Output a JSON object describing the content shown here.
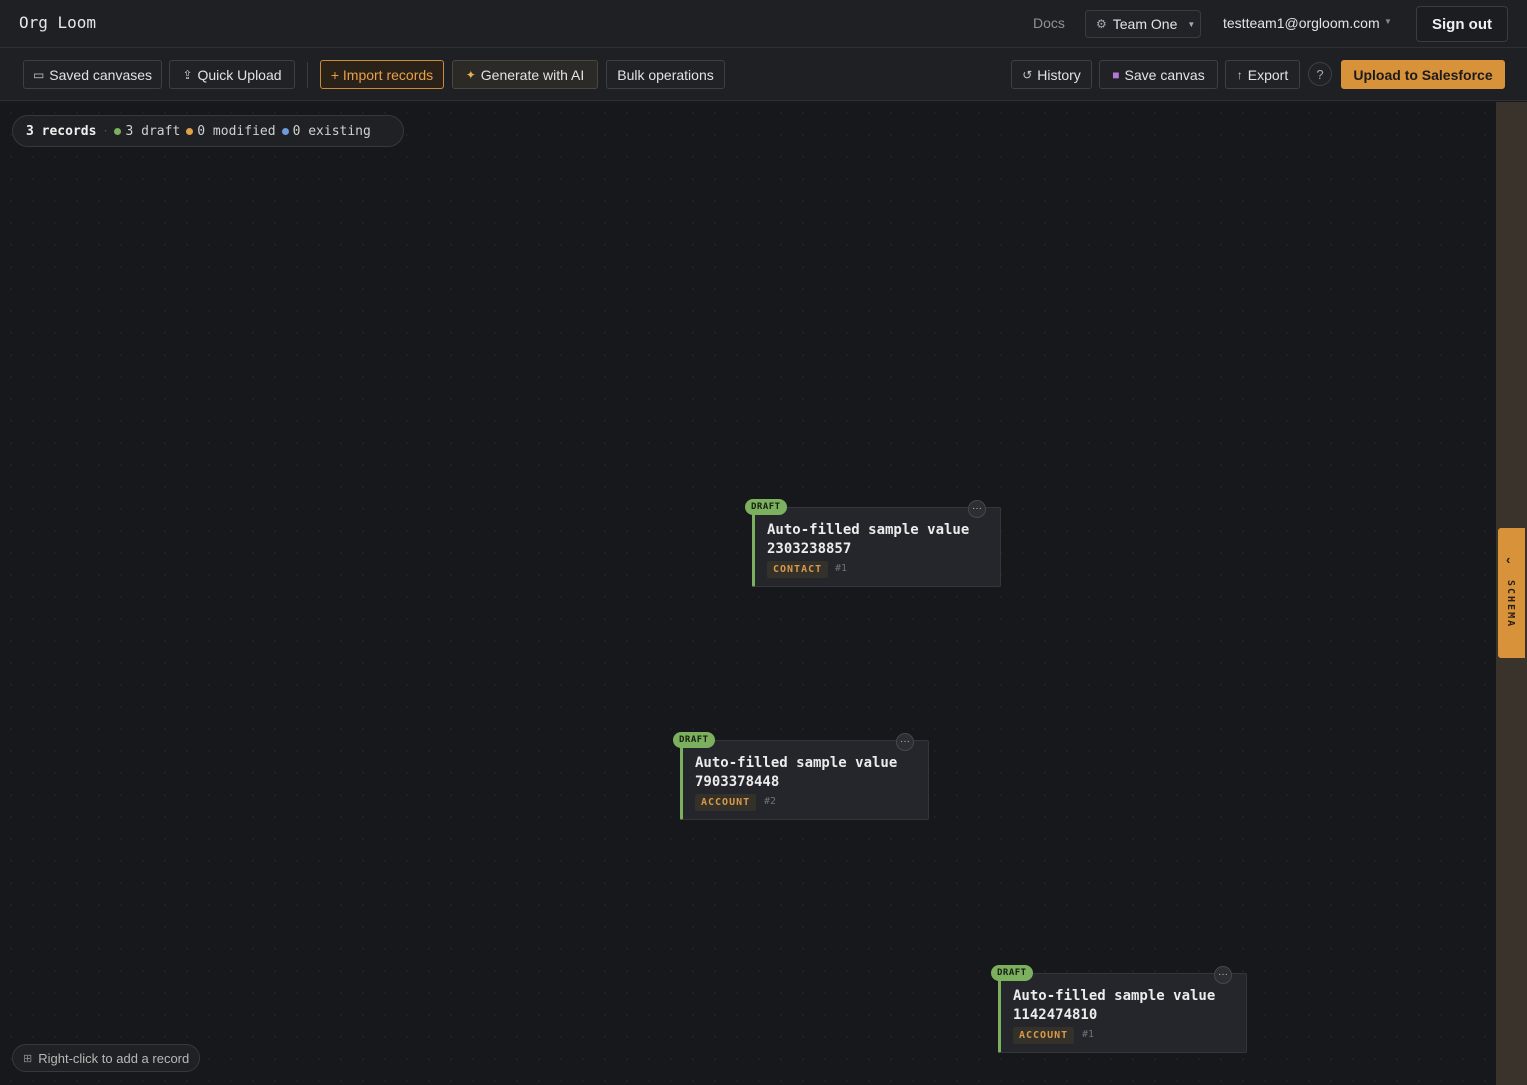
{
  "header": {
    "app_title": "Org Loom",
    "docs_label": "Docs",
    "team": "Team One",
    "user_email": "testteam1@orgloom.com",
    "signout_label": "Sign out"
  },
  "toolbar": {
    "saved_canvases": "Saved canvases",
    "quick_upload": "Quick Upload",
    "import_records": "+ Import records",
    "generate_ai": "Generate with AI",
    "bulk_operations": "Bulk operations",
    "history": "History",
    "save_canvas": "Save canvas",
    "export": "Export",
    "help": "?",
    "upload_salesforce": "Upload to Salesforce"
  },
  "summary": {
    "records": "3 records",
    "draft": "3 draft",
    "modified": "0 modified",
    "existing": "0 existing"
  },
  "colors": {
    "draft": "#7db05e",
    "modified": "#e2a04a",
    "existing": "#6f9bd8",
    "accent": "#d8923a"
  },
  "cards": [
    {
      "status": "DRAFT",
      "title": "Auto-filled sample value 2303238857",
      "type": "CONTACT",
      "number": "#1"
    },
    {
      "status": "DRAFT",
      "title": "Auto-filled sample value 7903378448",
      "type": "ACCOUNT",
      "number": "#2"
    },
    {
      "status": "DRAFT",
      "title": "Auto-filled sample value 1142474810",
      "type": "ACCOUNT",
      "number": "#1"
    }
  ],
  "schema_tab": {
    "label": "SCHEMA"
  },
  "hint": "Right-click to add a record",
  "icons": {
    "folder": "folder-icon",
    "upload": "upload-icon",
    "sparkle": "sparkle-icon",
    "history": "history-icon",
    "save": "floppy-icon",
    "export": "export-icon",
    "gear": "gear-icon",
    "grid": "grid-icon"
  }
}
